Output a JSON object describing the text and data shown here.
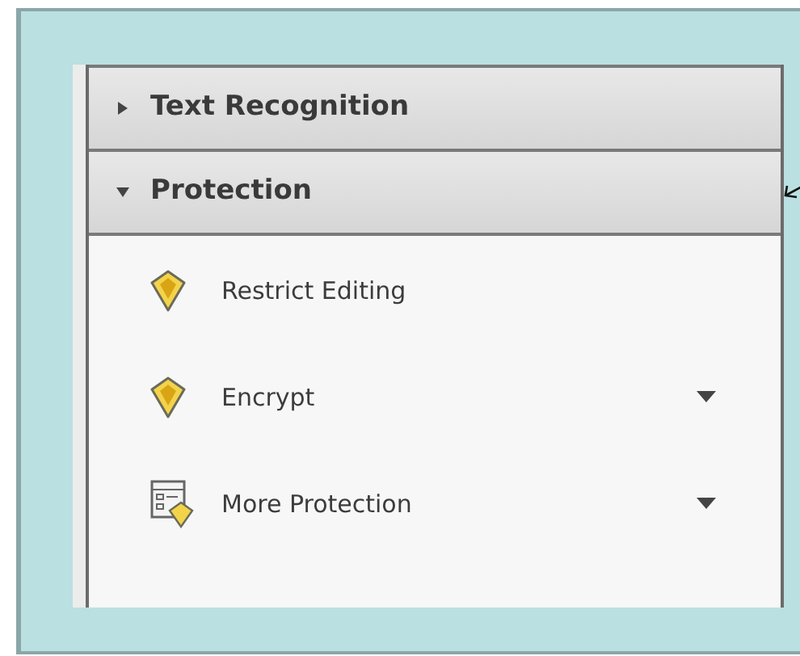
{
  "sections": [
    {
      "title": "Text Recognition",
      "expanded": false
    },
    {
      "title": "Protection",
      "expanded": true
    }
  ],
  "items": [
    {
      "label": "Restrict Editing",
      "kind": "shield",
      "has_menu": false
    },
    {
      "label": "Encrypt",
      "kind": "shield",
      "has_menu": true
    },
    {
      "label": "More Protection",
      "kind": "form",
      "has_menu": true
    }
  ]
}
